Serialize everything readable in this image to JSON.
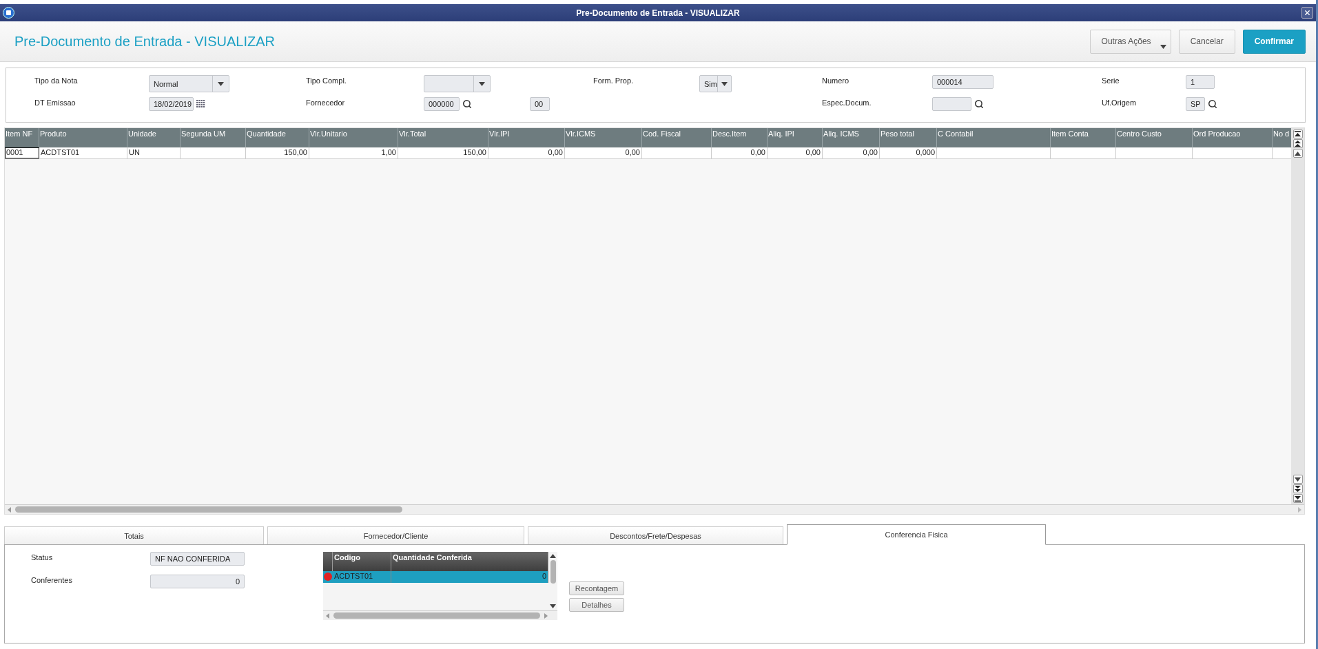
{
  "window": {
    "title": "Pre-Documento de Entrada - VISUALIZAR"
  },
  "header": {
    "title": "Pre-Documento de Entrada - VISUALIZAR",
    "buttons": [
      {
        "label": "Outras Ações",
        "kind": "menu"
      },
      {
        "label": "Cancelar",
        "kind": "default"
      },
      {
        "label": "Confirmar",
        "kind": "primary"
      }
    ]
  },
  "form": {
    "rows": [
      [
        {
          "label": "Tipo da Nota",
          "kind": "select",
          "value": "Normal"
        },
        {
          "label": "Tipo Compl.",
          "kind": "select"
        },
        {
          "label": "Form. Prop.",
          "kind": "select",
          "value": "Sim"
        },
        {
          "label": "Numero",
          "kind": "text",
          "value": "000014"
        },
        {
          "label": "Serie",
          "kind": "text",
          "value": "1"
        }
      ],
      [
        {
          "label": "DT Emissao",
          "kind": "date",
          "value": "18/02/2019"
        },
        {
          "label": "Fornecedor",
          "kind": "lookup",
          "value": "000000",
          "extra": "00"
        },
        "",
        {
          "label": "Espec.Docum.",
          "kind": "lookup"
        },
        {
          "label": "Uf.Origem",
          "kind": "lookup",
          "value": "SP"
        }
      ]
    ]
  },
  "grid": {
    "columns": [
      {
        "label": "Item NF"
      },
      {
        "label": "Produto"
      },
      {
        "label": "Unidade"
      },
      {
        "label": "Segunda UM"
      },
      {
        "label": "Quantidade"
      },
      {
        "label": "Vlr.Unitario"
      },
      {
        "label": "Vlr.Total"
      },
      {
        "label": "Vlr.IPI"
      },
      {
        "label": "Vlr.ICMS"
      },
      {
        "label": "Cod. Fiscal"
      },
      {
        "label": "Desc.Item"
      },
      {
        "label": "Aliq. IPI"
      },
      {
        "label": "Aliq. ICMS"
      },
      {
        "label": "Peso total"
      },
      {
        "label": "C Contabil"
      },
      {
        "label": "Item Conta"
      },
      {
        "label": "Centro Custo"
      },
      {
        "label": "Ord Producao"
      },
      {
        "label": "No d"
      }
    ],
    "rows": [
      {
        "selected": true,
        "cells": [
          "0001",
          "ACDTST01",
          "UN",
          "",
          "150,00",
          "1,00",
          "150,00",
          "0,00",
          "0,00",
          "",
          "0,00",
          "0,00",
          "0,00",
          "0,000",
          "",
          "",
          "",
          "",
          ""
        ]
      }
    ]
  },
  "tabs": [
    {
      "label": "Totais",
      "selected": false
    },
    {
      "label": "Fornecedor/Cliente",
      "selected": false
    },
    {
      "label": "Descontos/Frete/Despesas",
      "selected": false
    },
    {
      "label": "Conferencia Fisica",
      "selected": true
    }
  ],
  "conferencia": {
    "fields": [
      {
        "label": "Status",
        "value": "NF NAO CONFERIDA"
      },
      {
        "label": "Conferentes",
        "value": "0"
      }
    ],
    "list": {
      "columns": [
        "Codigo",
        "Quantidade Conferida"
      ],
      "rows": [
        {
          "codigo": "ACDTST01",
          "quantidade": "0",
          "selected": true,
          "color": "#e02424"
        }
      ]
    },
    "buttons": [
      "Recontagem",
      "Detalhes"
    ]
  }
}
